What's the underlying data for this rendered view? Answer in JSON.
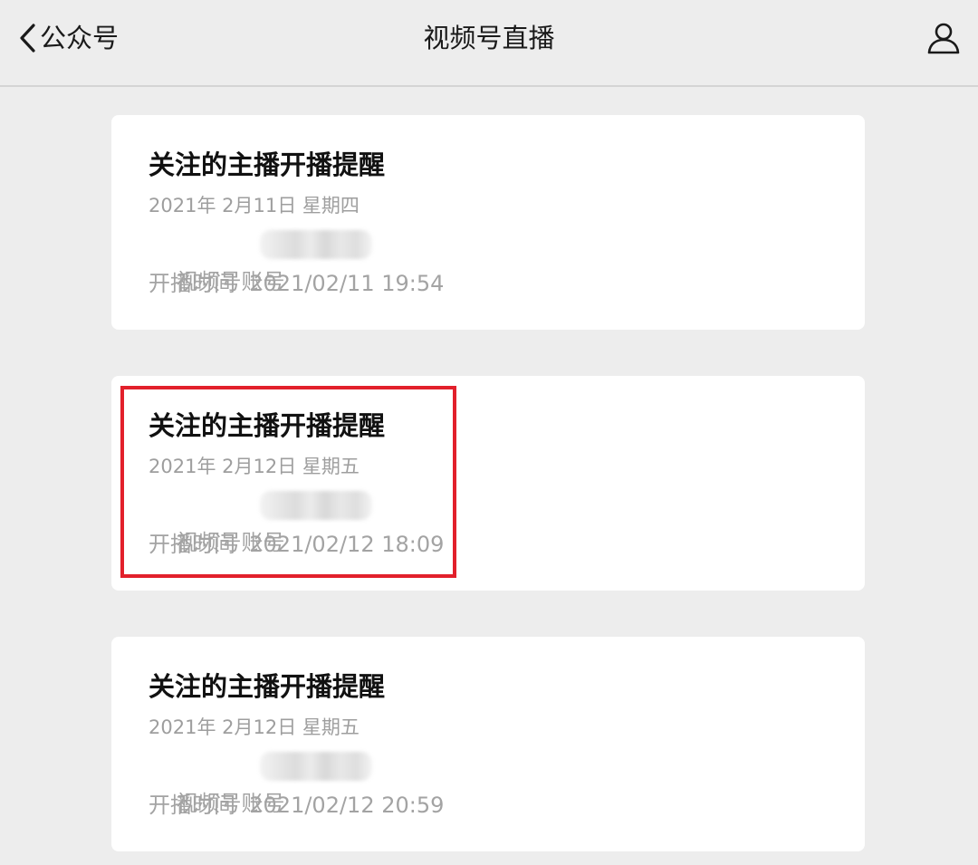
{
  "header": {
    "back_label": "公众号",
    "title": "视频号直播"
  },
  "cards": [
    {
      "title": "关注的主播开播提醒",
      "date": "2021年 2月11日 星期四",
      "account_label": "视频号账号",
      "time_label": "开播时间",
      "time_value": "2021/02/11 19:54"
    },
    {
      "title": "关注的主播开播提醒",
      "date": "2021年 2月12日 星期五",
      "account_label": "视频号账号",
      "time_label": "开播时间",
      "time_value": "2021/02/12 18:09",
      "highlighted": true
    },
    {
      "title": "关注的主播开播提醒",
      "date": "2021年 2月12日 星期五",
      "account_label": "视频号账号",
      "time_label": "开播时间",
      "time_value": "2021/02/12 20:59"
    }
  ],
  "icons": {
    "back": "chevron-left-icon",
    "profile": "person-icon"
  },
  "colors": {
    "background": "#ededed",
    "card": "#ffffff",
    "highlight": "#e2202b",
    "secondary_text": "#a3a3a3"
  }
}
